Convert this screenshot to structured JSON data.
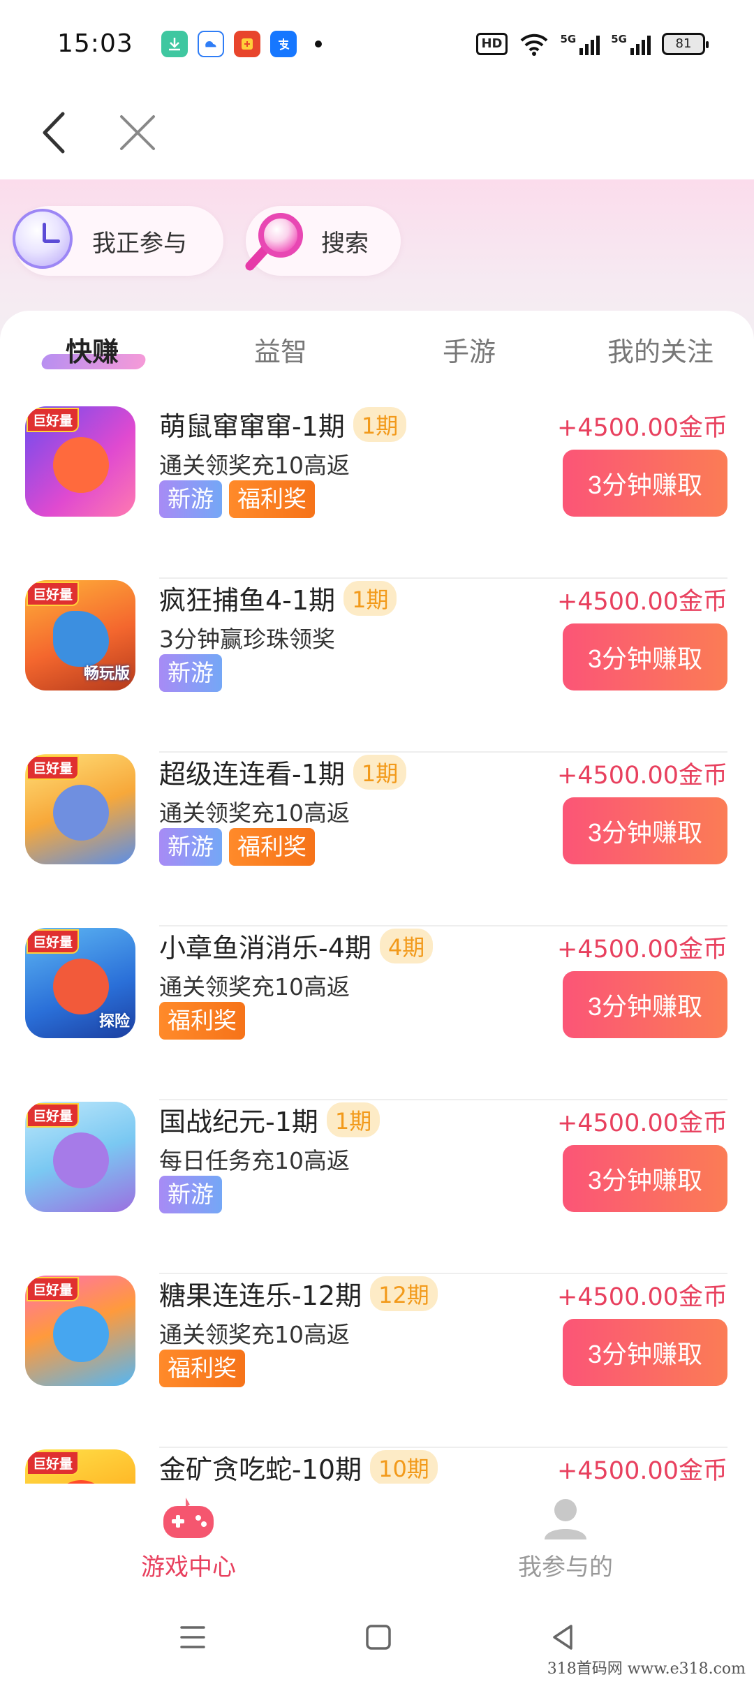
{
  "status_bar": {
    "time": "15:03",
    "battery": "81",
    "hd_label": "HD",
    "signal_labels": [
      "5G",
      "5G"
    ]
  },
  "hero": {
    "participating_label": "我正参与",
    "search_label": "搜索"
  },
  "tabs": [
    "快赚",
    "益智",
    "手游",
    "我的关注"
  ],
  "games": [
    {
      "title": "萌鼠窜窜窜-1期",
      "period": "1期",
      "desc": "通关领奖充10高返",
      "tags": [
        "新游",
        "福利奖"
      ],
      "coins": "+4500.00金币",
      "button": "3分钟赚取",
      "icon_badge": "巨好量",
      "icon_sub": ""
    },
    {
      "title": "疯狂捕鱼4-1期",
      "period": "1期",
      "desc": "3分钟赢珍珠领奖",
      "tags": [
        "新游"
      ],
      "coins": "+4500.00金币",
      "button": "3分钟赚取",
      "icon_badge": "巨好量",
      "icon_sub": "畅玩版"
    },
    {
      "title": "超级连连看-1期",
      "period": "1期",
      "desc": "通关领奖充10高返",
      "tags": [
        "新游",
        "福利奖"
      ],
      "coins": "+4500.00金币",
      "button": "3分钟赚取",
      "icon_badge": "巨好量",
      "icon_sub": ""
    },
    {
      "title": "小章鱼消消乐-4期",
      "period": "4期",
      "desc": "通关领奖充10高返",
      "tags": [
        "福利奖"
      ],
      "coins": "+4500.00金币",
      "button": "3分钟赚取",
      "icon_badge": "巨好量",
      "icon_sub": "探险"
    },
    {
      "title": "国战纪元-1期",
      "period": "1期",
      "desc": "每日任务充10高返",
      "tags": [
        "新游"
      ],
      "coins": "+4500.00金币",
      "button": "3分钟赚取",
      "icon_badge": "巨好量",
      "icon_sub": ""
    },
    {
      "title": "糖果连连乐-12期",
      "period": "12期",
      "desc": "通关领奖充10高返",
      "tags": [
        "福利奖"
      ],
      "coins": "+4500.00金币",
      "button": "3分钟赚取",
      "icon_badge": "巨好量",
      "icon_sub": ""
    },
    {
      "title": "金矿贪吃蛇-10期",
      "period": "10期",
      "desc": "",
      "tags": [],
      "coins": "+4500.00金币",
      "button": "",
      "icon_badge": "巨好量",
      "icon_sub": ""
    }
  ],
  "bottom_tabs": {
    "game_center": "游戏中心",
    "my_participation": "我参与的"
  },
  "watermark": "318首码网 www.e318.com",
  "colors": {
    "accent": "#e8405e",
    "button_gradient_start": "#fb5577",
    "button_gradient_end": "#fb7c55",
    "tag_new": "#a78bf5",
    "tag_fuli": "#ff8a2a",
    "period_bg": "#fdebc6",
    "period_text": "#f29a1b"
  }
}
